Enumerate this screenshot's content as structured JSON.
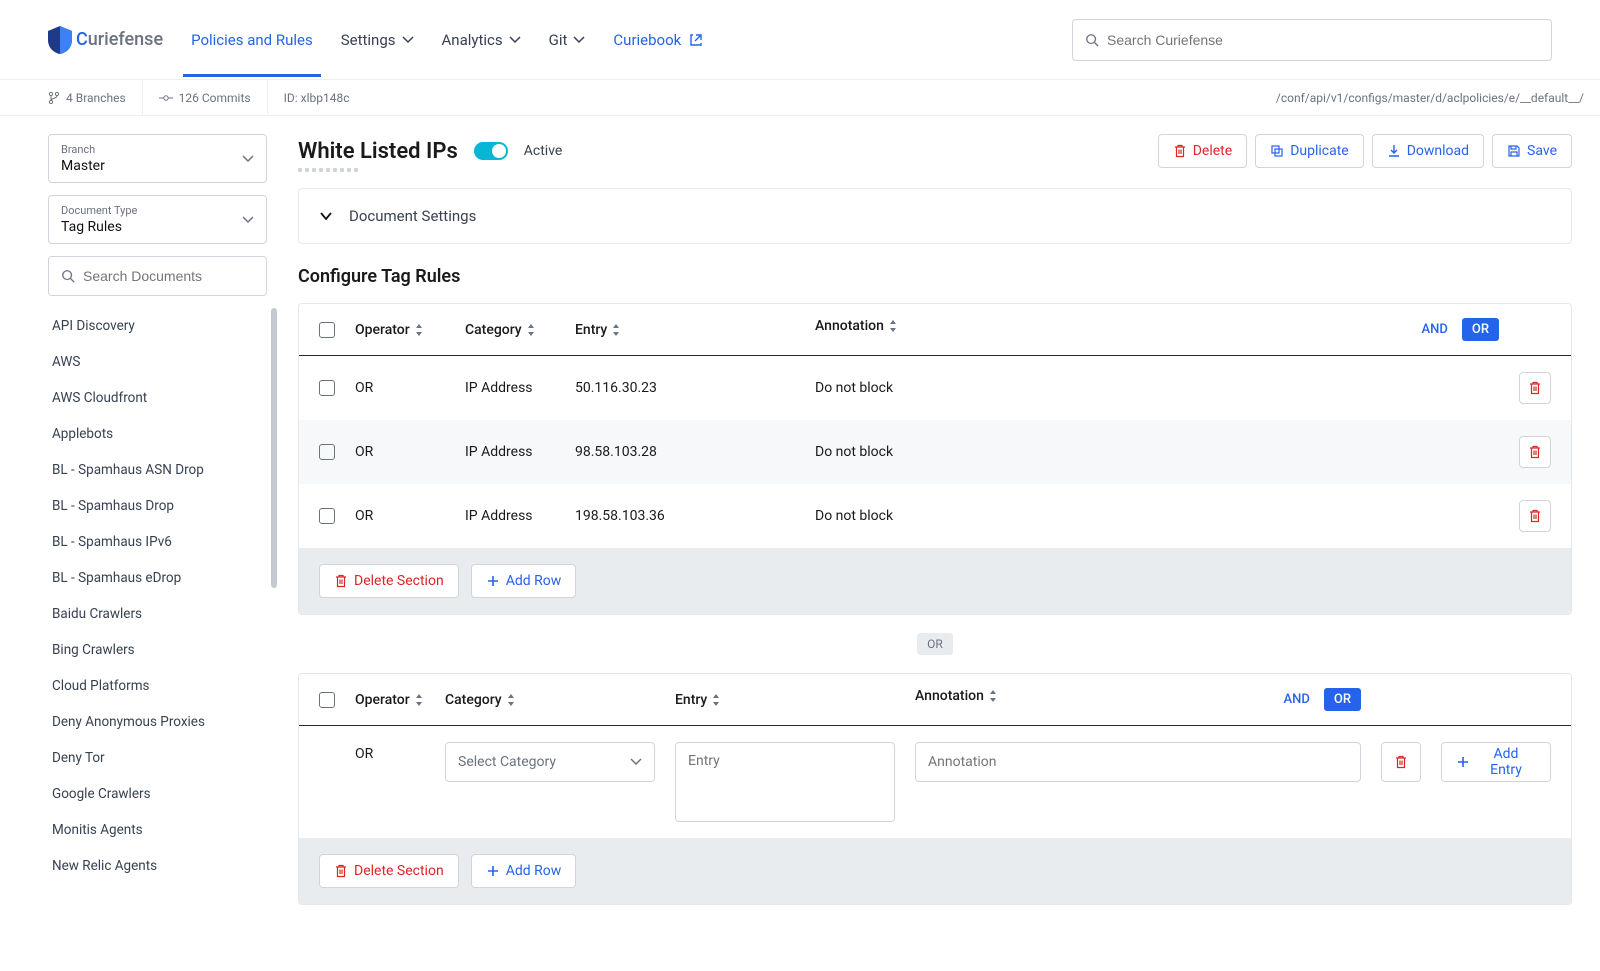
{
  "brand": {
    "name_c": "C",
    "name_rest": "uriefense"
  },
  "nav": {
    "policies": "Policies and Rules",
    "settings": "Settings",
    "analytics": "Analytics",
    "git": "Git",
    "curiebook": "Curiebook"
  },
  "search_placeholder": "Search Curiefense",
  "subbar": {
    "branches": "4 Branches",
    "commits": "126 Commits",
    "id": "ID: xlbp148c",
    "path": "/conf/api/v1/configs/master/d/aclpolicies/e/__default__/"
  },
  "sidebar": {
    "branch_label": "Branch",
    "branch_value": "Master",
    "doctype_label": "Document Type",
    "doctype_value": "Tag Rules",
    "search_placeholder": "Search Documents",
    "items": [
      "API Discovery",
      "AWS",
      "AWS Cloudfront",
      "Applebots",
      "BL - Spamhaus ASN Drop",
      "BL - Spamhaus Drop",
      "BL - Spamhaus IPv6",
      "BL - Spamhaus eDrop",
      "Baidu Crawlers",
      "Bing Crawlers",
      "Cloud Platforms",
      "Deny Anonymous Proxies",
      "Deny Tor",
      "Google Crawlers",
      "Monitis Agents",
      "New Relic Agents"
    ]
  },
  "page": {
    "title": "White Listed IPs",
    "active_label": "Active",
    "delete": "Delete",
    "duplicate": "Duplicate",
    "download": "Download",
    "save": "Save"
  },
  "doc_settings": "Document Settings",
  "configure_title": "Configure Tag Rules",
  "table": {
    "h_operator": "Operator",
    "h_category": "Category",
    "h_entry": "Entry",
    "h_annotation": "Annotation",
    "and": "AND",
    "or": "OR"
  },
  "section1": {
    "rows": [
      {
        "op": "OR",
        "cat": "IP Address",
        "entry": "50.116.30.23",
        "ann": "Do not block"
      },
      {
        "op": "OR",
        "cat": "IP Address",
        "entry": "98.58.103.28",
        "ann": "Do not block"
      },
      {
        "op": "OR",
        "cat": "IP Address",
        "entry": "198.58.103.36",
        "ann": "Do not block"
      }
    ]
  },
  "section_actions": {
    "delete_section": "Delete Section",
    "add_row": "Add Row"
  },
  "or_sep": "OR",
  "section2": {
    "row_op": "OR",
    "category_placeholder": "Select Category",
    "entry_placeholder": "Entry",
    "annotation_placeholder": "Annotation",
    "add_entry": "Add Entry"
  }
}
